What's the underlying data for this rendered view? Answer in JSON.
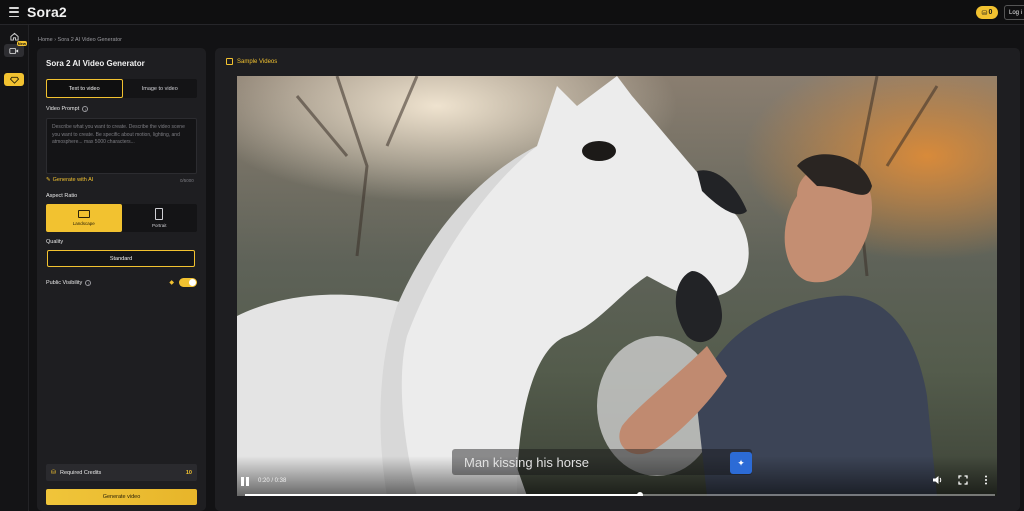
{
  "header": {
    "logo": "Sora2",
    "credits": "0",
    "login_label": "Log i"
  },
  "rail": {
    "new_tag": "New"
  },
  "breadcrumb": "Home › Sora 2 AI Video Generator",
  "panel": {
    "title": "Sora 2 AI Video Generator",
    "tabs": [
      {
        "label": "Text to video",
        "active": true
      },
      {
        "label": "Image to video",
        "active": false
      }
    ],
    "prompt_label": "Video Prompt",
    "prompt_placeholder": "Describe what you want to create. Describe the video scene you want to create. Be specific about motion, lighting, and atmosphere... max 5000 characters...",
    "generate_ai_label": "Generate with AI",
    "char_count": "0/5000",
    "aspect_label": "Aspect Ratio",
    "aspect_options": [
      {
        "label": "Landscape",
        "active": true
      },
      {
        "label": "Portrait",
        "active": false
      }
    ],
    "quality_label": "Quality",
    "quality_value": "Standard",
    "visibility_label": "Public Visibility",
    "visibility_on": true,
    "credits_label": "Required Credits",
    "credits_value": "10",
    "generate_button": "Generate video"
  },
  "samples": {
    "title": "Sample Videos",
    "caption": "Man kissing his horse",
    "time": "0:20 / 0:38",
    "progress": 0.526
  },
  "colors": {
    "accent": "#f2c230",
    "caption_button": "#2c6bd6"
  }
}
